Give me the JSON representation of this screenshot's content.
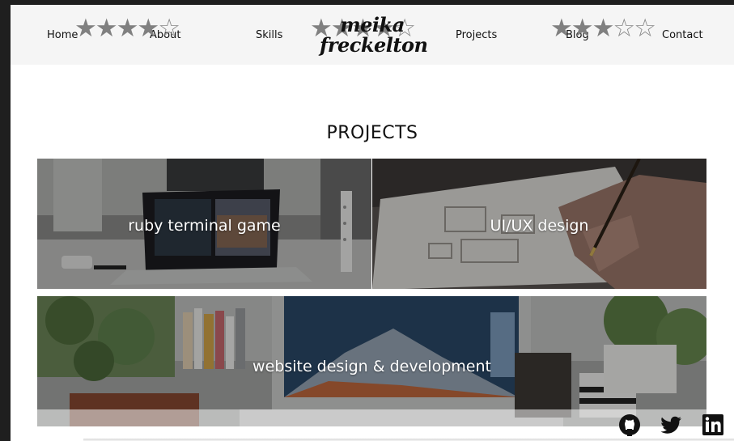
{
  "nav": {
    "links": {
      "home": "Home",
      "about": "About",
      "skills": "Skills",
      "projects": "Projects",
      "blog": "Blog",
      "contact": "Contact"
    },
    "logo_line1": "meika",
    "logo_line2": "freckelton"
  },
  "ratings": [
    {
      "filled": 4,
      "total": 5
    },
    {
      "filled": 4,
      "total": 5
    },
    {
      "filled": 3,
      "total": 5
    }
  ],
  "projects": {
    "heading": "PROJECTS",
    "cards": [
      {
        "label": "ruby terminal game"
      },
      {
        "label": "UI/UX design"
      },
      {
        "label": "website design & development"
      }
    ]
  },
  "social": [
    "github-icon",
    "twitter-icon",
    "linkedin-icon"
  ],
  "colors": {
    "nav_bg": "#f5f5f5",
    "accent_pink": "#e05a64",
    "text": "#111111",
    "star": "#808080"
  }
}
